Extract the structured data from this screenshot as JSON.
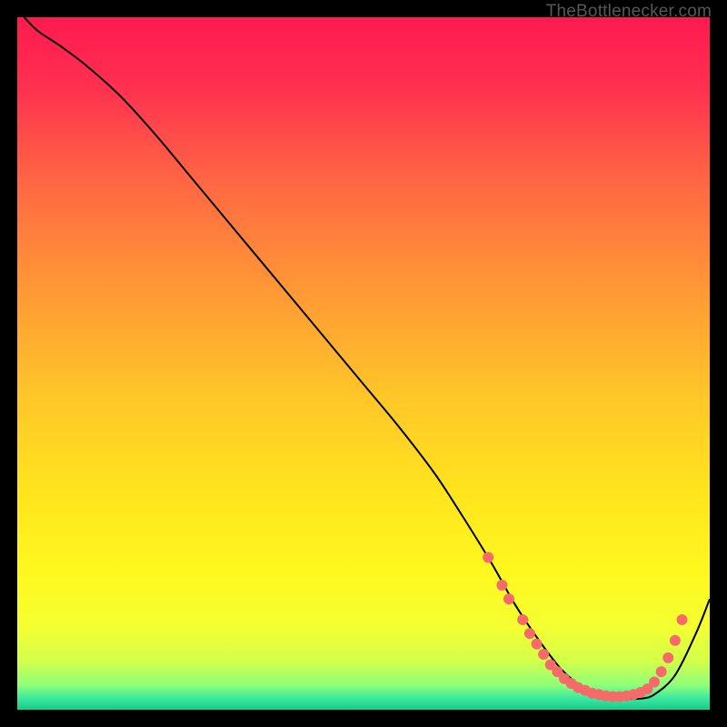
{
  "watermark": "TheBottleneсker.com",
  "chart_data": {
    "type": "line",
    "title": "",
    "xlabel": "",
    "ylabel": "",
    "xlim": [
      0,
      100
    ],
    "ylim": [
      0,
      100
    ],
    "grid": false,
    "series": [
      {
        "name": "bottleneck-curve",
        "x": [
          1,
          3,
          6,
          10,
          15,
          20,
          25,
          30,
          35,
          40,
          45,
          50,
          55,
          60,
          63,
          68,
          70,
          72,
          75,
          78,
          80,
          82,
          84,
          86,
          88,
          90,
          92,
          95,
          98,
          100
        ],
        "y": [
          100,
          98,
          96,
          93,
          88.5,
          83,
          77,
          71,
          65,
          59,
          53,
          47,
          41,
          34.5,
          30,
          22,
          18.5,
          15,
          10.5,
          6.5,
          4.5,
          3.0,
          2.2,
          1.8,
          1.6,
          1.6,
          2.2,
          5.0,
          11,
          16
        ],
        "color": "#000000"
      }
    ],
    "points": {
      "name": "highlighted-points",
      "color": "#f76a6a",
      "radius": 6,
      "values": [
        {
          "x": 68,
          "y": 22.0
        },
        {
          "x": 70,
          "y": 18.0
        },
        {
          "x": 71,
          "y": 16.0
        },
        {
          "x": 73,
          "y": 13.0
        },
        {
          "x": 74,
          "y": 11.0
        },
        {
          "x": 75,
          "y": 9.5
        },
        {
          "x": 76,
          "y": 8.0
        },
        {
          "x": 77,
          "y": 6.5
        },
        {
          "x": 78,
          "y": 5.5
        },
        {
          "x": 79,
          "y": 4.5
        },
        {
          "x": 80,
          "y": 3.8
        },
        {
          "x": 81,
          "y": 3.2
        },
        {
          "x": 82,
          "y": 2.8
        },
        {
          "x": 83,
          "y": 2.4
        },
        {
          "x": 84,
          "y": 2.2
        },
        {
          "x": 85,
          "y": 2.0
        },
        {
          "x": 86,
          "y": 1.9
        },
        {
          "x": 87,
          "y": 1.9
        },
        {
          "x": 88,
          "y": 2.0
        },
        {
          "x": 89,
          "y": 2.2
        },
        {
          "x": 90,
          "y": 2.5
        },
        {
          "x": 91,
          "y": 3.0
        },
        {
          "x": 92,
          "y": 4.0
        },
        {
          "x": 93,
          "y": 5.5
        },
        {
          "x": 94,
          "y": 7.5
        },
        {
          "x": 95,
          "y": 10.0
        },
        {
          "x": 96,
          "y": 13.0
        }
      ]
    },
    "background_gradient": {
      "stops": [
        {
          "pos": 0.0,
          "color": "#ff1a4f"
        },
        {
          "pos": 0.1,
          "color": "#ff3050"
        },
        {
          "pos": 0.25,
          "color": "#ff6b42"
        },
        {
          "pos": 0.4,
          "color": "#ff9a35"
        },
        {
          "pos": 0.55,
          "color": "#ffc728"
        },
        {
          "pos": 0.68,
          "color": "#ffe31e"
        },
        {
          "pos": 0.8,
          "color": "#fff81f"
        },
        {
          "pos": 0.88,
          "color": "#f4ff30"
        },
        {
          "pos": 0.93,
          "color": "#d3ff4a"
        },
        {
          "pos": 0.965,
          "color": "#8dff7a"
        },
        {
          "pos": 0.985,
          "color": "#35e7a0"
        },
        {
          "pos": 1.0,
          "color": "#18c988"
        }
      ]
    }
  }
}
